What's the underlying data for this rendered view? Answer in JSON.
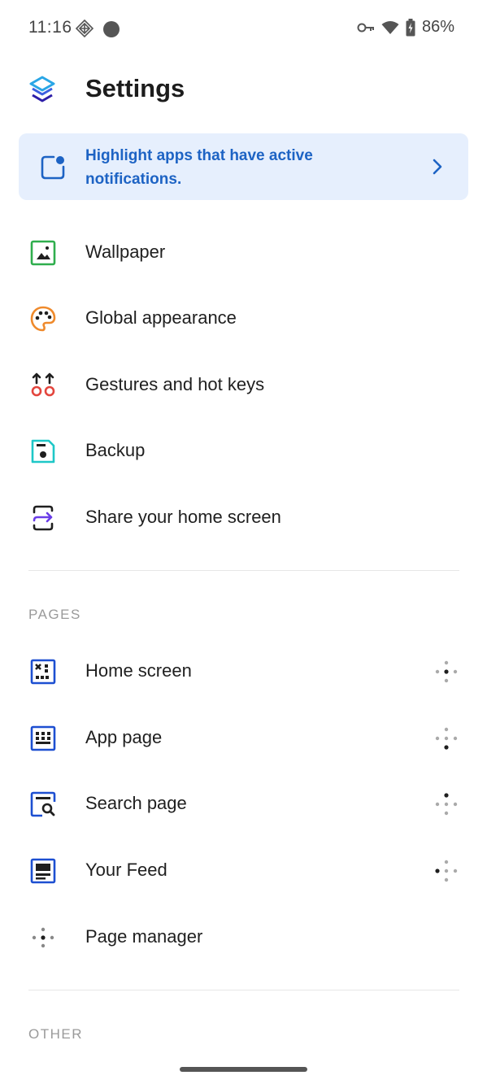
{
  "status_bar": {
    "time": "11:16",
    "battery": "86%",
    "left_icons": [
      "signal-diamond-icon",
      "dot-icon"
    ],
    "right_icons": [
      "vpn-key-icon",
      "wifi-icon",
      "battery-charging-icon"
    ]
  },
  "header": {
    "title": "Settings",
    "logo": "app-logo-icon"
  },
  "banner": {
    "text": "Highlight apps that have active notifications.",
    "icon": "notification-dot-icon",
    "accent": "#1d63c4",
    "background": "#e6effd"
  },
  "general_items": [
    {
      "label": "Wallpaper",
      "icon": "image-icon",
      "color": "#2fae4d"
    },
    {
      "label": "Global appearance",
      "icon": "palette-icon",
      "color": "#ef8a2c"
    },
    {
      "label": "Gestures and hot keys",
      "icon": "gestures-icon",
      "color": "#e3463e"
    },
    {
      "label": "Backup",
      "icon": "backup-icon",
      "color": "#1ec7c7"
    },
    {
      "label": "Share your home screen",
      "icon": "share-icon",
      "color": "#6a3de8"
    }
  ],
  "pages_section": {
    "header": "PAGES",
    "items": [
      {
        "label": "Home screen",
        "icon": "home-screen-icon",
        "color": "#1d4fd1"
      },
      {
        "label": "App page",
        "icon": "app-grid-icon",
        "color": "#1d4fd1"
      },
      {
        "label": "Search page",
        "icon": "search-page-icon",
        "color": "#1d4fd1"
      },
      {
        "label": "Your Feed",
        "icon": "feed-icon",
        "color": "#1d4fd1"
      },
      {
        "label": "Page manager",
        "icon": "page-manager-icon",
        "color": "#777777"
      }
    ]
  },
  "other_section": {
    "header": "OTHER"
  }
}
